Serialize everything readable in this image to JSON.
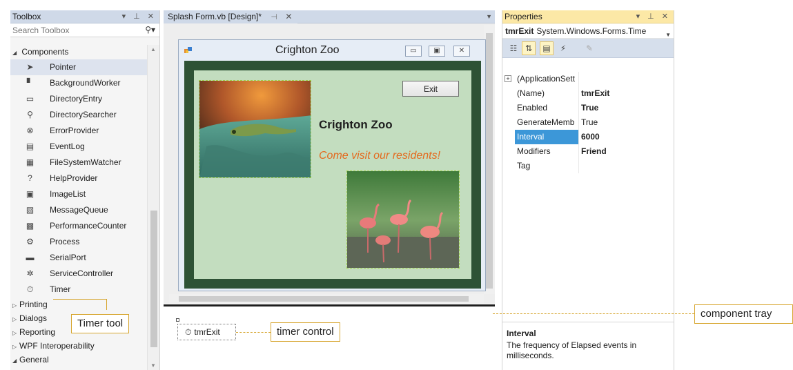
{
  "toolbox": {
    "title": "Toolbox",
    "title_controls": "▾ ⊥ ✕",
    "search_placeholder": "Search Toolbox",
    "groups_top": [
      {
        "label": "Components",
        "expanded": true
      }
    ],
    "items": [
      {
        "label": "Pointer",
        "icon": "pointer-icon",
        "glyph": "➤",
        "selected": true
      },
      {
        "label": "BackgroundWorker",
        "icon": "background-worker-icon",
        "glyph": "▘"
      },
      {
        "label": "DirectoryEntry",
        "icon": "directory-entry-icon",
        "glyph": "▭"
      },
      {
        "label": "DirectorySearcher",
        "icon": "directory-searcher-icon",
        "glyph": "⚲"
      },
      {
        "label": "ErrorProvider",
        "icon": "error-provider-icon",
        "glyph": "⊗"
      },
      {
        "label": "EventLog",
        "icon": "event-log-icon",
        "glyph": "▤"
      },
      {
        "label": "FileSystemWatcher",
        "icon": "file-system-watcher-icon",
        "glyph": "▦"
      },
      {
        "label": "HelpProvider",
        "icon": "help-provider-icon",
        "glyph": "?"
      },
      {
        "label": "ImageList",
        "icon": "image-list-icon",
        "glyph": "▣"
      },
      {
        "label": "MessageQueue",
        "icon": "message-queue-icon",
        "glyph": "▧"
      },
      {
        "label": "PerformanceCounter",
        "icon": "performance-counter-icon",
        "glyph": "▩"
      },
      {
        "label": "Process",
        "icon": "process-icon",
        "glyph": "⚙"
      },
      {
        "label": "SerialPort",
        "icon": "serial-port-icon",
        "glyph": "▬"
      },
      {
        "label": "ServiceController",
        "icon": "service-controller-icon",
        "glyph": "✲"
      },
      {
        "label": "Timer",
        "icon": "timer-icon",
        "glyph": "⏱"
      }
    ],
    "groups_bottom": [
      {
        "label": "Printing",
        "expanded": false
      },
      {
        "label": "Dialogs",
        "expanded": false
      },
      {
        "label": "Reporting",
        "expanded": false
      },
      {
        "label": "WPF Interoperability",
        "expanded": false
      },
      {
        "label": "General",
        "expanded": true
      }
    ]
  },
  "designer": {
    "tab_label": "Splash Form.vb [Design]*",
    "tab_pin": "⊣",
    "tab_close": "✕",
    "form": {
      "title": "Crighton Zoo",
      "exit_button": "Exit",
      "title_label": "Crighton Zoo",
      "tagline": "Come visit our residents!",
      "pictures": [
        "lizard-picture",
        "flamingo-picture"
      ]
    },
    "tray": {
      "component_name": "tmrExit"
    }
  },
  "properties": {
    "title": "Properties",
    "title_controls": "▾ ⊥ ✕",
    "object_name": "tmrExit",
    "object_type": "System.Windows.Forms.Time",
    "rows": [
      {
        "name": "(ApplicationSett",
        "value": "",
        "bold": false,
        "expander": "+"
      },
      {
        "name": "(Name)",
        "value": "tmrExit",
        "bold": true
      },
      {
        "name": "Enabled",
        "value": "True",
        "bold": true
      },
      {
        "name": "GenerateMemb",
        "value": "True",
        "bold": false
      },
      {
        "name": "Interval",
        "value": "6000",
        "bold": true,
        "selected": true
      },
      {
        "name": "Modifiers",
        "value": "Friend",
        "bold": true
      },
      {
        "name": "Tag",
        "value": "",
        "bold": false
      }
    ],
    "description_title": "Interval",
    "description_text": "The frequency of Elapsed events in milliseconds."
  },
  "callouts": {
    "timer_tool": "Timer tool",
    "timer_control": "timer control",
    "component_tray": "component tray"
  },
  "colors": {
    "callout_border": "#d6a42b",
    "form_background": "#2e5235",
    "form_inner": "#c3ddbf",
    "tagline": "#e46a1e",
    "selected_property": "#3c97d8"
  }
}
